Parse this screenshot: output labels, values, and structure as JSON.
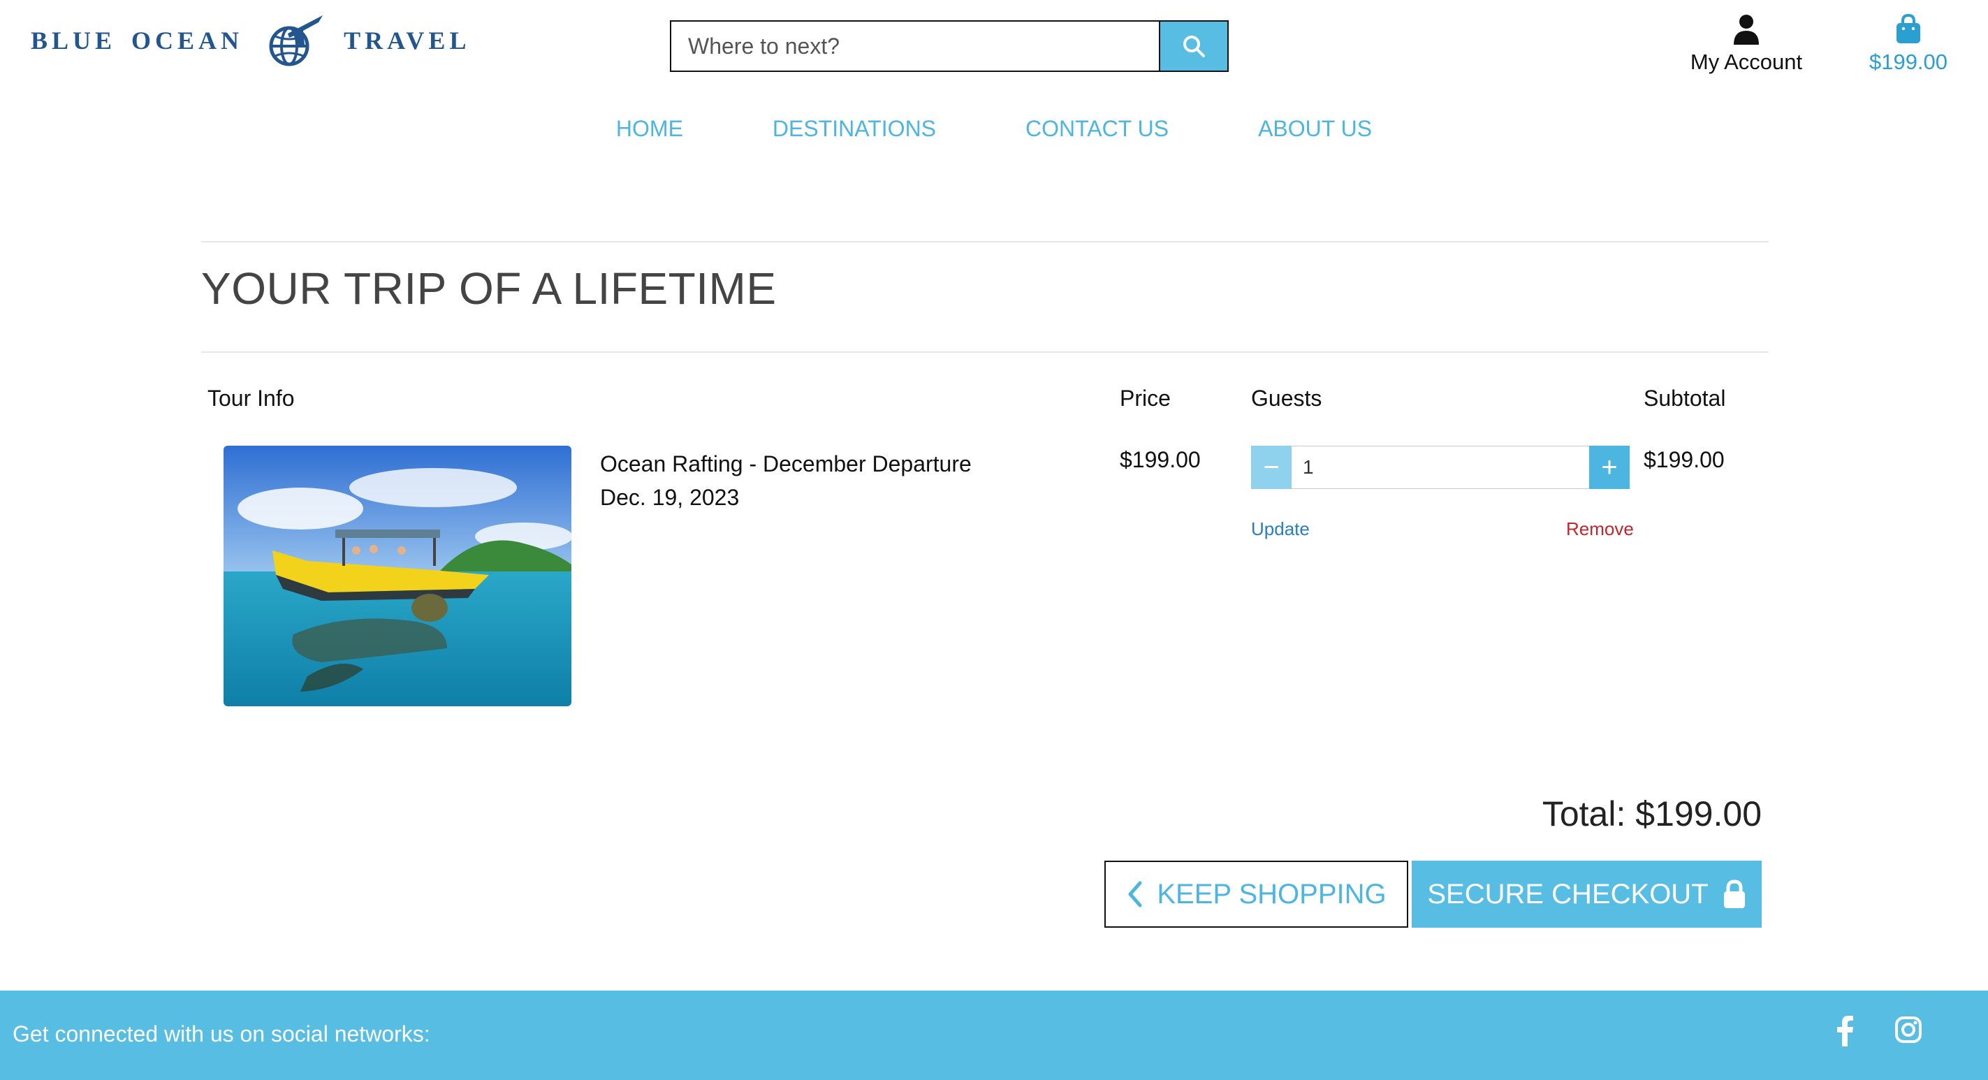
{
  "brand": {
    "word1": "BLUE",
    "word2": "OCEAN",
    "word3": "TRAVEL",
    "emblem_icon": "globe-plane-icon",
    "color": "#23558f"
  },
  "search": {
    "placeholder": "Where to next?",
    "button_icon": "search-icon"
  },
  "account": {
    "label": "My Account",
    "icon": "user-icon"
  },
  "cart": {
    "amount": "$199.00",
    "icon": "shopping-bag-icon"
  },
  "nav": {
    "items": [
      {
        "label": "HOME"
      },
      {
        "label": "DESTINATIONS"
      },
      {
        "label": "CONTACT US"
      },
      {
        "label": "ABOUT US"
      }
    ]
  },
  "page": {
    "title": "YOUR TRIP OF A LIFETIME"
  },
  "table": {
    "headers": {
      "tour_info": "Tour Info",
      "price": "Price",
      "guests": "Guests",
      "subtotal": "Subtotal"
    },
    "rows": [
      {
        "name": "Ocean Rafting - December Departure",
        "date": "Dec. 19, 2023",
        "price": "$199.00",
        "guests": "1",
        "subtotal": "$199.00",
        "update_label": "Update",
        "remove_label": "Remove",
        "minus_label": "−",
        "plus_label": "+"
      }
    ]
  },
  "summary": {
    "total": "Total: $199.00"
  },
  "actions": {
    "keep_shopping": "KEEP SHOPPING",
    "secure_checkout": "SECURE CHECKOUT"
  },
  "footer": {
    "text": "Get connected with us on social networks:",
    "icons": [
      "facebook-icon",
      "instagram-icon"
    ]
  },
  "colors": {
    "accent": "#57bde3",
    "link": "#4cb6e0",
    "remove": "#c0272d",
    "update": "#2a7fb8"
  }
}
